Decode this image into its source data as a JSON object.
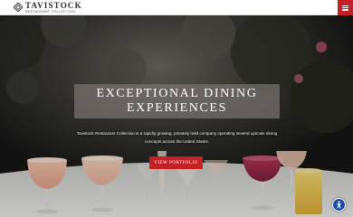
{
  "header": {
    "logo_name": "TAVISTOCK",
    "logo_subtitle": "RESTAURANT COLLECTION",
    "menu_icon": "hamburger-menu-icon",
    "accent_color": "#c42127"
  },
  "hero": {
    "headline": "EXCEPTIONAL DINING EXPERIENCES",
    "description": "Tavistock Restaurant Collection is a rapidly growing, privately held company operating several upscale dining concepts across the United States.",
    "cta_label": "VIEW PORTFOLIO",
    "background_image": "cocktail glasses on a marble bar table"
  },
  "accessibility": {
    "icon": "accessibility-person-icon"
  }
}
